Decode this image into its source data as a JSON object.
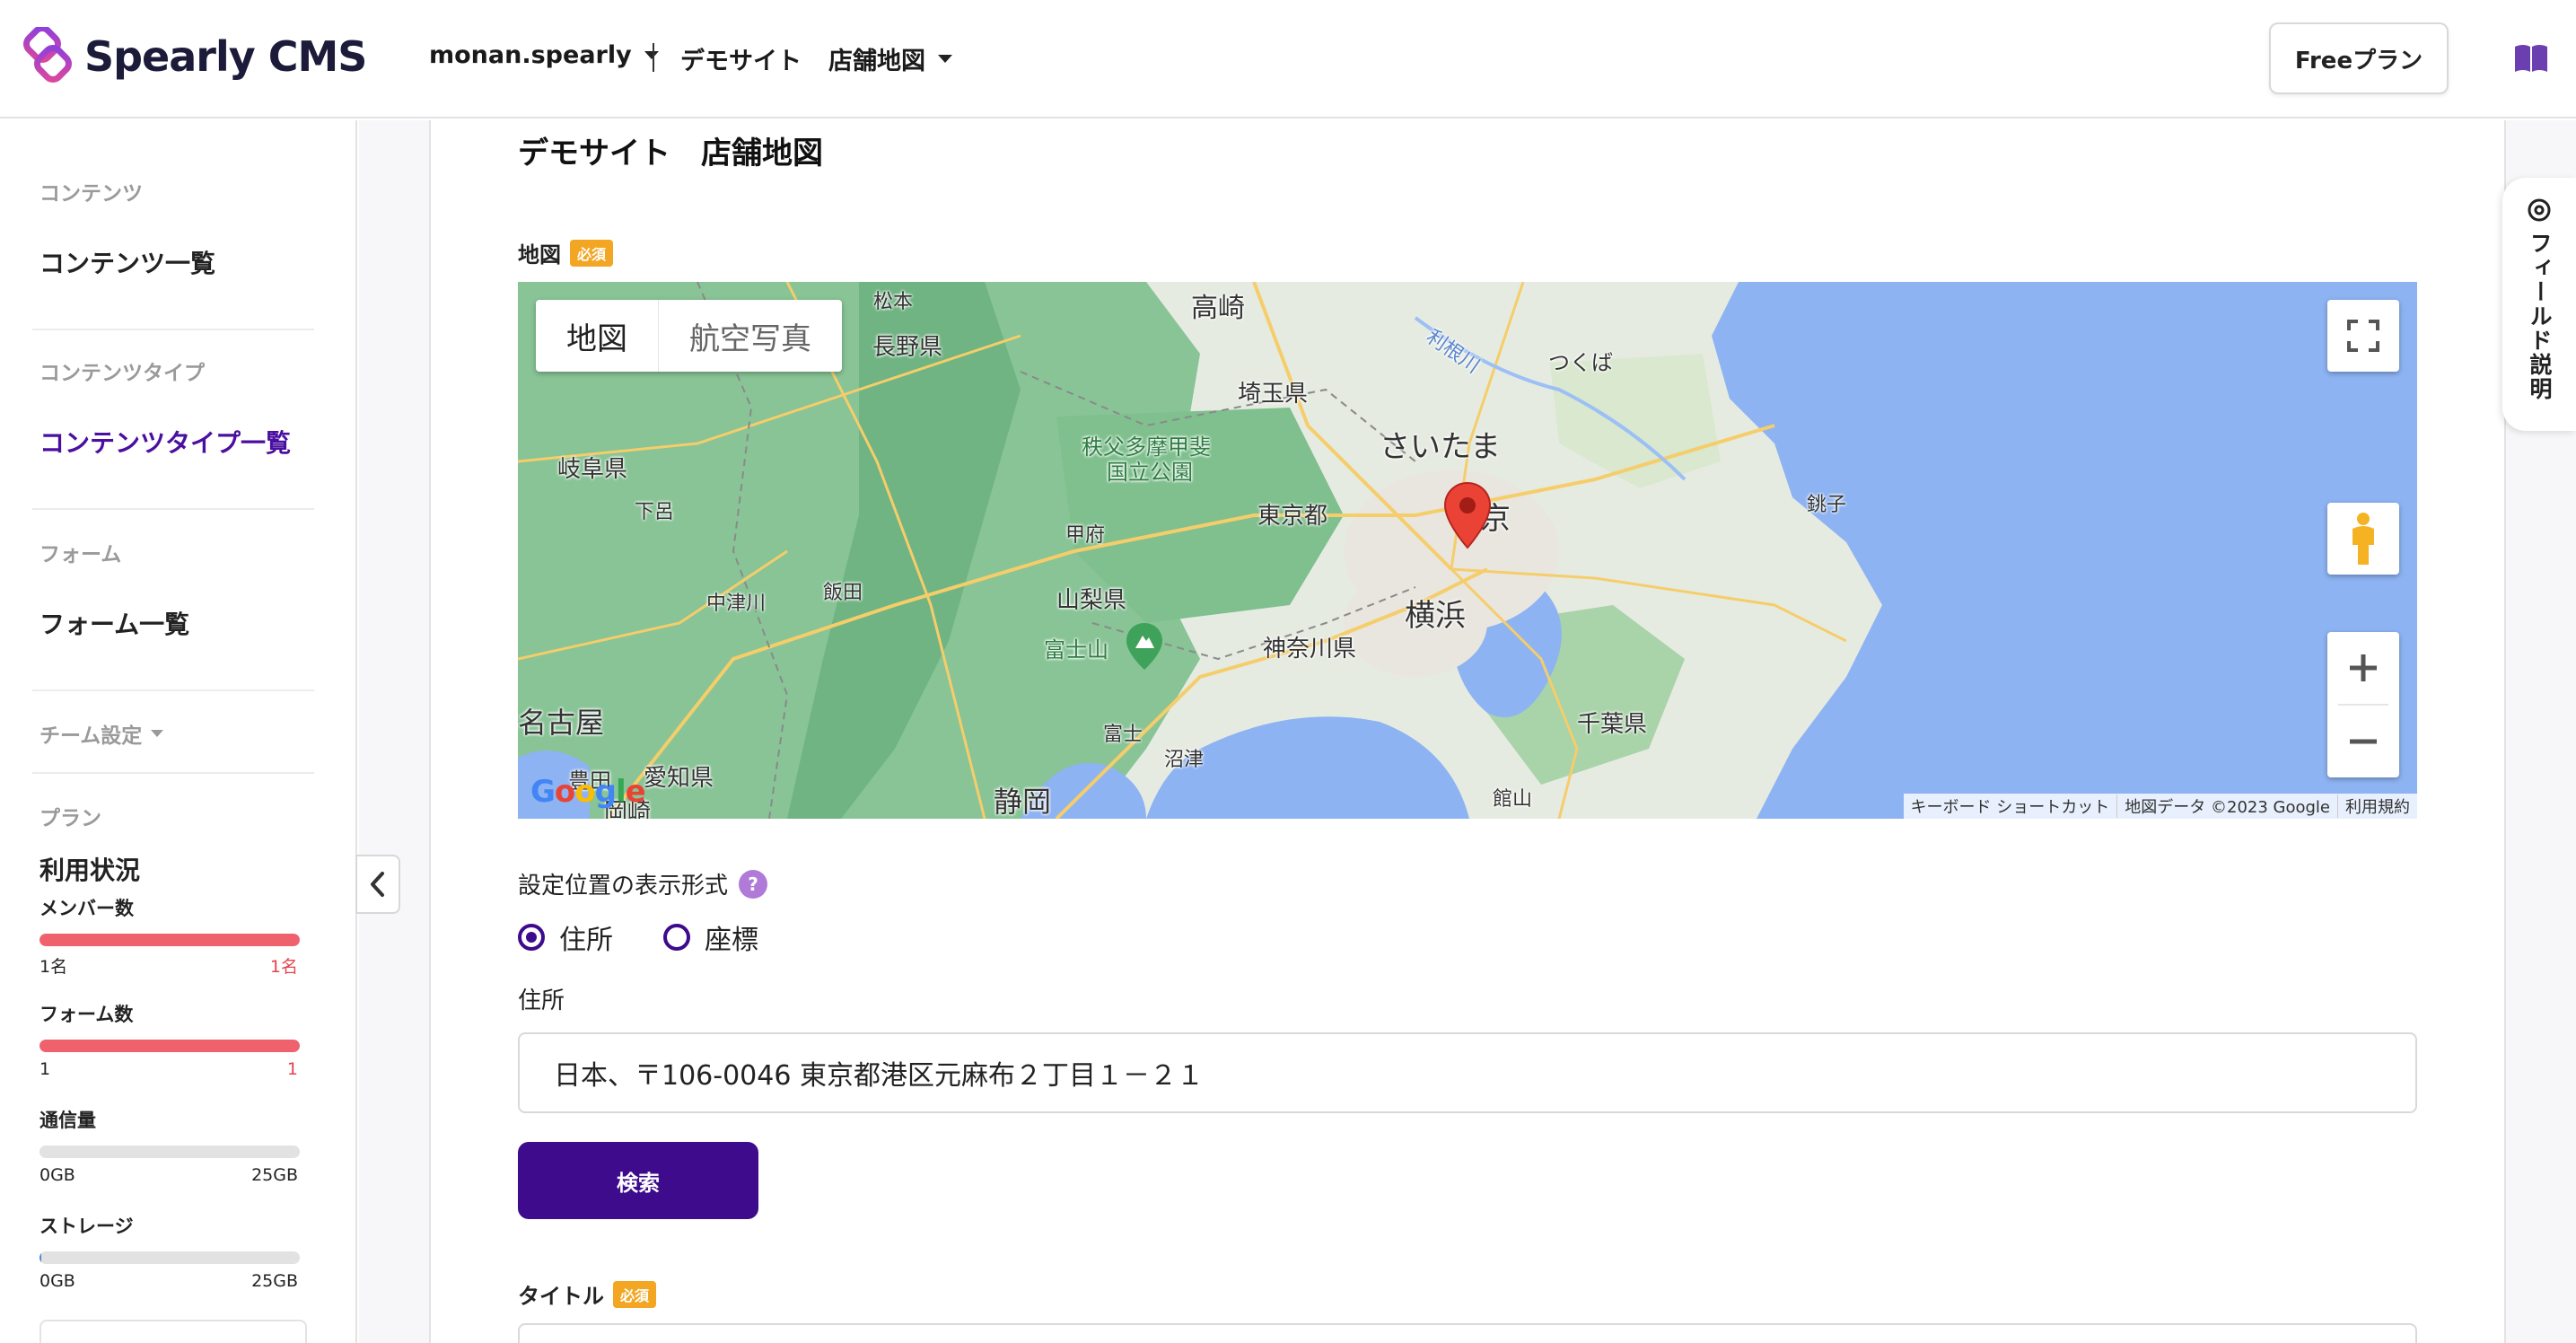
{
  "header": {
    "logo_text": "Spearly CMS",
    "team_name": "monan.spearly",
    "breadcrumb_site": "デモサイト",
    "breadcrumb_type": "店舗地図",
    "plan_label": "Freeプラン"
  },
  "sidebar": {
    "sections": [
      {
        "heading": "コンテンツ",
        "link": "コンテンツ一覧"
      },
      {
        "heading": "コンテンツタイプ",
        "link": "コンテンツタイプ一覧"
      },
      {
        "heading": "フォーム",
        "link": "フォーム一覧"
      }
    ],
    "team_settings": "チーム設定",
    "plan_heading": "プラン",
    "usage_title": "利用状況",
    "usage": [
      {
        "label": "メンバー数",
        "min": "1名",
        "max": "1名",
        "fill": 1.0,
        "color": "#f0616e"
      },
      {
        "label": "フォーム数",
        "min": "1",
        "max": "1",
        "fill": 1.0,
        "color": "#f0616e"
      },
      {
        "label": "通信量",
        "min": "0GB",
        "max": "25GB",
        "fill": 0.0,
        "color": "#f0616e"
      },
      {
        "label": "ストレージ",
        "min": "0GB",
        "max": "25GB",
        "fill": 0.005,
        "color": "#3f8bd8"
      }
    ]
  },
  "field_help": "フィールド説明",
  "main": {
    "page_title": "デモサイト　店舗地図",
    "map_field_label": "地図",
    "required": "必須",
    "map": {
      "type_map": "地図",
      "type_satellite": "航空写真",
      "attribution": [
        "キーボード ショートカット",
        "地図データ ©2023 Google",
        "利用規約"
      ],
      "google_logo": "Google",
      "place_labels": [
        {
          "text": "高崎",
          "size": 30
        },
        {
          "text": "長野県",
          "size": 26
        },
        {
          "text": "松本",
          "size": 22
        },
        {
          "text": "埼玉県",
          "size": 26
        },
        {
          "text": "つくば",
          "size": 24
        },
        {
          "text": "利根川",
          "size": 22
        },
        {
          "text": "さいたま",
          "size": 34
        },
        {
          "text": "秩父多摩甲斐",
          "size": 24
        },
        {
          "text": "国立公園",
          "size": 24
        },
        {
          "text": "岐阜県",
          "size": 26
        },
        {
          "text": "下呂",
          "size": 22
        },
        {
          "text": "東京都",
          "size": 26
        },
        {
          "text": "京",
          "size": 34
        },
        {
          "text": "銚子",
          "size": 22
        },
        {
          "text": "甲府",
          "size": 22
        },
        {
          "text": "中津川",
          "size": 22
        },
        {
          "text": "飯田",
          "size": 22
        },
        {
          "text": "山梨県",
          "size": 26
        },
        {
          "text": "横浜",
          "size": 34
        },
        {
          "text": "富士山",
          "size": 24
        },
        {
          "text": "神奈川県",
          "size": 26
        },
        {
          "text": "名古屋",
          "size": 32
        },
        {
          "text": "千葉県",
          "size": 26
        },
        {
          "text": "富士",
          "size": 22
        },
        {
          "text": "沼津",
          "size": 22
        },
        {
          "text": "豊田",
          "size": 24
        },
        {
          "text": "愛知県",
          "size": 26
        },
        {
          "text": "静岡",
          "size": 32
        },
        {
          "text": "館山",
          "size": 22
        },
        {
          "text": "岡崎",
          "size": 26
        }
      ]
    },
    "format_label": "設定位置の表示形式",
    "help_glyph": "?",
    "radio_address": "住所",
    "radio_coords": "座標",
    "address_label": "住所",
    "address_value": "日本、〒106-0046 東京都港区元麻布２丁目１－２１",
    "search_button": "検索",
    "title_field_label": "タイトル"
  },
  "colors": {
    "primary": "#3d0b8c",
    "active_link": "#4a0fa0",
    "required_badge": "#f2a623",
    "usage_full": "#f0616e",
    "map_water": "#8db3f2",
    "map_land": "#e8ede4",
    "map_forest": "#7fc08e"
  }
}
